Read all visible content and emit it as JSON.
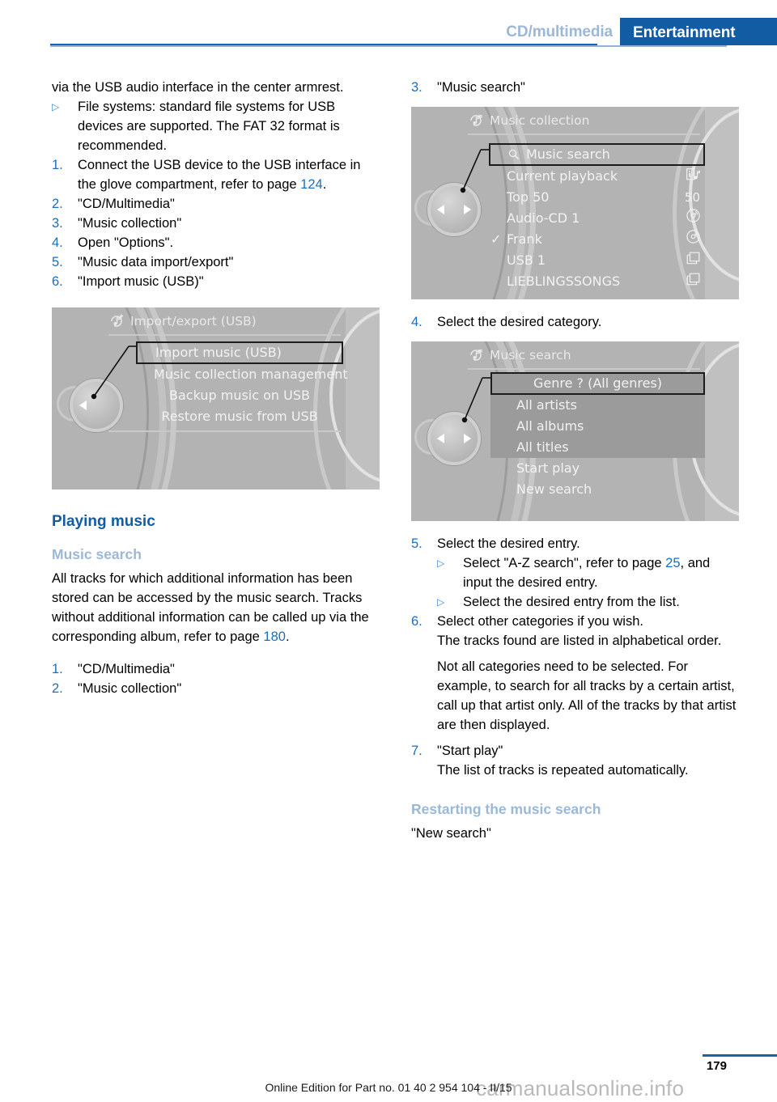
{
  "header": {
    "tab_inactive": "CD/multimedia",
    "tab_active": "Entertainment",
    "accent_blue": "#125ca3",
    "inactive_blue": "#9ab8d8"
  },
  "left_column": {
    "intro_text": "via the USB audio interface in the center armrest.",
    "bullet_filesystems": {
      "marker": "▷",
      "text": "File systems: standard file systems for USB devices are supported. The FAT 32 format is recommended."
    },
    "steps": [
      {
        "num": "1.",
        "text_before": "Connect the USB device to the USB interface in the glove compartment, refer to page ",
        "page_ref": "124",
        "text_after": "."
      },
      {
        "num": "2.",
        "text_before": "\"CD/Multimedia\"",
        "page_ref": "",
        "text_after": ""
      },
      {
        "num": "3.",
        "text_before": "\"Music collection\"",
        "page_ref": "",
        "text_after": ""
      },
      {
        "num": "4.",
        "text_before": "Open \"Options\".",
        "page_ref": "",
        "text_after": ""
      },
      {
        "num": "5.",
        "text_before": "\"Music data import/export\"",
        "page_ref": "",
        "text_after": ""
      },
      {
        "num": "6.",
        "text_before": "\"Import music (USB)\"",
        "page_ref": "",
        "text_after": ""
      }
    ],
    "figure_import_export": {
      "title": "Import/export (USB)",
      "title_icon": "music-import-icon",
      "items": [
        {
          "label": "Import music (USB)",
          "selected": true,
          "align": "left"
        },
        {
          "label": "Music collection management",
          "selected": false,
          "align": "left"
        },
        {
          "label": "Backup music on USB",
          "selected": false,
          "align": "center"
        },
        {
          "label": "Restore music from USB",
          "selected": false,
          "align": "center"
        }
      ]
    },
    "heading_playing_music": "Playing music",
    "heading_music_search": "Music search",
    "music_search_paragraph": {
      "text_before": "All tracks for which additional information has been stored can be accessed by the music search. Tracks without additional information can be called up via the corresponding album, refer to page ",
      "page_ref": "180",
      "text_after": "."
    },
    "steps2": [
      {
        "num": "1.",
        "text": "\"CD/Multimedia\""
      },
      {
        "num": "2.",
        "text": "\"Music collection\""
      }
    ]
  },
  "right_column": {
    "step3": {
      "num": "3.",
      "text": "\"Music search\""
    },
    "figure_music_collection": {
      "title": "Music collection",
      "title_icon": "music-note-icon",
      "items": [
        {
          "label": "Music search",
          "selected": true,
          "icon": "search-icon",
          "right_icon": "",
          "check": false
        },
        {
          "label": "Current playback",
          "selected": false,
          "icon": "",
          "right_icon": "info-music-icon",
          "check": false
        },
        {
          "label": "Top 50",
          "selected": false,
          "icon": "",
          "right_icon": "50",
          "check": false
        },
        {
          "label": "Audio-CD 1",
          "selected": false,
          "icon": "",
          "right_icon": "disc-icon",
          "check": false
        },
        {
          "label": "Frank",
          "selected": false,
          "icon": "",
          "right_icon": "disc-icon",
          "check": true
        },
        {
          "label": "USB 1",
          "selected": false,
          "icon": "",
          "right_icon": "folder-icon",
          "check": false
        },
        {
          "label": "LIEBLINGSSONGS",
          "selected": false,
          "icon": "",
          "right_icon": "folder-icon",
          "check": false
        }
      ]
    },
    "step4": {
      "num": "4.",
      "text": "Select the desired category."
    },
    "figure_music_search": {
      "title": "Music search",
      "title_icon": "music-note-icon",
      "items": [
        {
          "label": "Genre ? (All genres)",
          "selected": true,
          "bar": true
        },
        {
          "label": "All artists",
          "selected": false,
          "bar": true
        },
        {
          "label": "All albums",
          "selected": false,
          "bar": true
        },
        {
          "label": "All titles",
          "selected": false,
          "bar": true
        },
        {
          "label": "Start play",
          "selected": false,
          "bar": false
        },
        {
          "label": "New search",
          "selected": false,
          "bar": false
        }
      ]
    },
    "step5": {
      "num": "5.",
      "text": "Select the desired entry."
    },
    "step5_sub": [
      {
        "marker": "▷",
        "text_before": "Select \"A-Z search\", refer to page ",
        "page_ref": "25",
        "text_after": ", and input the desired entry."
      },
      {
        "marker": "▷",
        "text_before": "Select the desired entry from the list.",
        "page_ref": "",
        "text_after": ""
      }
    ],
    "step6": {
      "num": "6.",
      "text": "Select other categories if you wish."
    },
    "step6_note1": "The tracks found are listed in alphabetical order.",
    "step6_note2": "Not all categories need to be selected. For example, to search for all tracks by a certain artist, call up that artist only. All of the tracks by that artist are then displayed.",
    "step7": {
      "num": "7.",
      "text": "\"Start play\""
    },
    "step7_note": "The list of tracks is repeated automatically.",
    "heading_restarting": "Restarting the music search",
    "restarting_text": "\"New search\""
  },
  "footer": {
    "page_number": "179",
    "edition_text": "Online Edition for Part no. 01 40 2 954 104 - II/15",
    "watermark": "carmanualsonline.info"
  }
}
